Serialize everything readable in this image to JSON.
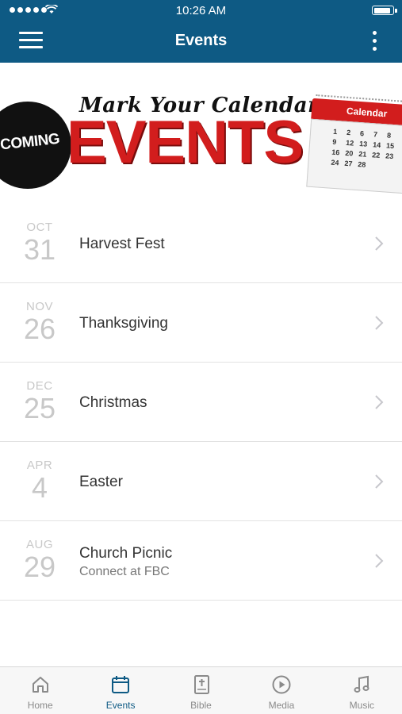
{
  "status_bar": {
    "time": "10:26 AM"
  },
  "nav": {
    "title": "Events",
    "menu_icon": "hamburger-menu-icon",
    "more_icon": "more-vertical-icon"
  },
  "banner": {
    "tagline": "Mark Your Calendars",
    "headline": "EVENTS",
    "badge": "PCOMING",
    "calendar_label": "Calendar",
    "calendar_days": [
      "1",
      "2",
      "6",
      "7",
      "8",
      "9",
      "12",
      "13",
      "14",
      "15",
      "16",
      "20",
      "21",
      "22",
      "23",
      "24",
      "27",
      "28"
    ]
  },
  "events": [
    {
      "month": "OCT",
      "day": "31",
      "title": "Harvest Fest",
      "subtitle": ""
    },
    {
      "month": "NOV",
      "day": "26",
      "title": "Thanksgiving",
      "subtitle": ""
    },
    {
      "month": "DEC",
      "day": "25",
      "title": "Christmas",
      "subtitle": ""
    },
    {
      "month": "APR",
      "day": "4",
      "title": "Easter",
      "subtitle": ""
    },
    {
      "month": "AUG",
      "day": "29",
      "title": "Church Picnic",
      "subtitle": "Connect at FBC"
    }
  ],
  "tabs": [
    {
      "label": "Home",
      "icon": "home-icon",
      "active": false
    },
    {
      "label": "Events",
      "icon": "calendar-icon",
      "active": true
    },
    {
      "label": "Bible",
      "icon": "bible-icon",
      "active": false
    },
    {
      "label": "Media",
      "icon": "play-icon",
      "active": false
    },
    {
      "label": "Music",
      "icon": "music-note-icon",
      "active": false
    }
  ],
  "colors": {
    "header": "#0e5a84",
    "active_tab": "#0e5a84",
    "banner_red": "#d21d1d"
  }
}
